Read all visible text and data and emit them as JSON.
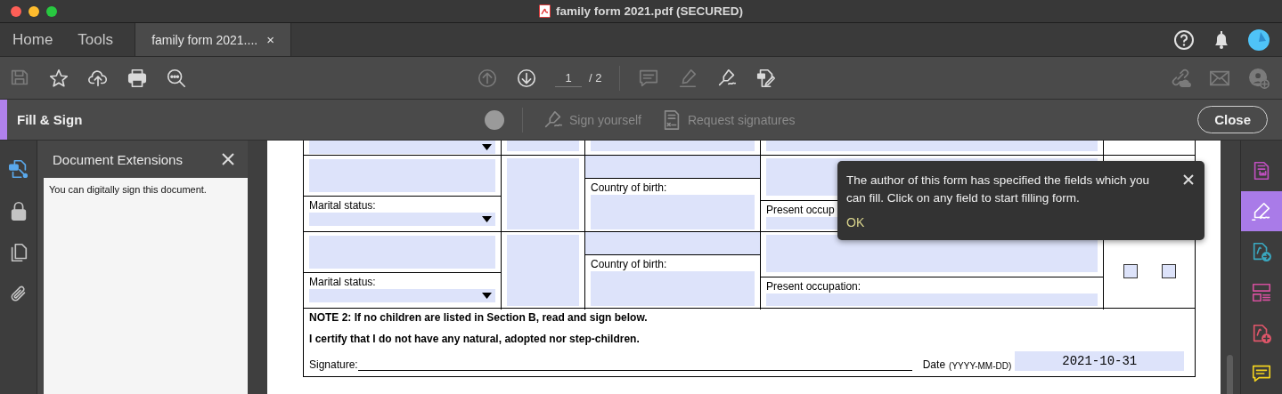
{
  "window": {
    "title": "family form 2021.pdf (SECURED)"
  },
  "tabs": [
    {
      "label": "Home",
      "selected": false
    },
    {
      "label": "Tools",
      "selected": false
    },
    {
      "label": "family form 2021....",
      "selected": true,
      "close": "×"
    }
  ],
  "toolbar": {
    "left": [
      {
        "kind": "save",
        "disabled": true
      },
      {
        "kind": "star",
        "disabled": false
      },
      {
        "kind": "upload",
        "disabled": false
      },
      {
        "kind": "print",
        "disabled": false
      },
      {
        "kind": "zoom",
        "disabled": false
      }
    ],
    "nav": [
      {
        "kind": "up",
        "disabled": true
      },
      {
        "kind": "down",
        "disabled": false
      }
    ],
    "page": "1",
    "page_total": "/ 2",
    "tools": [
      {
        "kind": "comment",
        "disabled": true
      },
      {
        "kind": "highlight",
        "disabled": true
      },
      {
        "kind": "sign",
        "disabled": false
      },
      {
        "kind": "edit",
        "disabled": false
      }
    ],
    "right": [
      {
        "kind": "link",
        "disabled": true
      },
      {
        "kind": "mail",
        "disabled": true
      },
      {
        "kind": "adduser",
        "disabled": true
      }
    ]
  },
  "fill_sign": {
    "title": "Fill & Sign",
    "actions": [
      {
        "kind": "sign",
        "label": "Sign yourself",
        "disabled": true
      },
      {
        "kind": "request",
        "label": "Request signatures",
        "disabled": true
      }
    ],
    "close": "Close"
  },
  "left_rail": [
    {
      "kind": "extensions",
      "selected": true
    },
    {
      "kind": "lock",
      "selected": false
    },
    {
      "kind": "copy",
      "selected": false
    },
    {
      "kind": "clip",
      "selected": false
    }
  ],
  "panel": {
    "title": "Document Extensions",
    "body": "You can digitally sign this document."
  },
  "form": {
    "rows": [
      {
        "kind": "partial"
      },
      {
        "kind": "child",
        "marital_label": "Marital status:",
        "country_label": "Country of birth:",
        "occupation_label": "Present occup",
        "checkboxes": []
      },
      {
        "kind": "child",
        "marital_label": "Marital status:",
        "country_label": "Country of birth:",
        "occupation_label": "Present occupation:",
        "checkboxes": [
          {
            "checked": false
          },
          {
            "checked": false
          }
        ]
      }
    ],
    "note": {
      "title": "NOTE 2: If no children are listed in Section B, read and sign below.",
      "statement": "I certify that I do not have any natural, adopted nor step-children.",
      "signature_label": "Signature:",
      "date_label": "Date",
      "date_format": "(YYYY-MM-DD)",
      "date_value": "2021-10-31"
    }
  },
  "tooltip": {
    "text": "The author of this form has specified the fields which you can fill. Click on any field to start filling form.",
    "ok": "OK"
  },
  "right_rail": [
    {
      "kind": "export",
      "color": "#c04fc0",
      "selected": false
    },
    {
      "kind": "fillsign",
      "color": "#ffffff",
      "selected": true
    },
    {
      "kind": "convert",
      "color": "#3aa8c0",
      "selected": false
    },
    {
      "kind": "organize",
      "color": "#d24f9c",
      "selected": false
    },
    {
      "kind": "create",
      "color": "#e0566a",
      "selected": false
    },
    {
      "kind": "comment",
      "color": "#f2d21e",
      "selected": false
    }
  ]
}
